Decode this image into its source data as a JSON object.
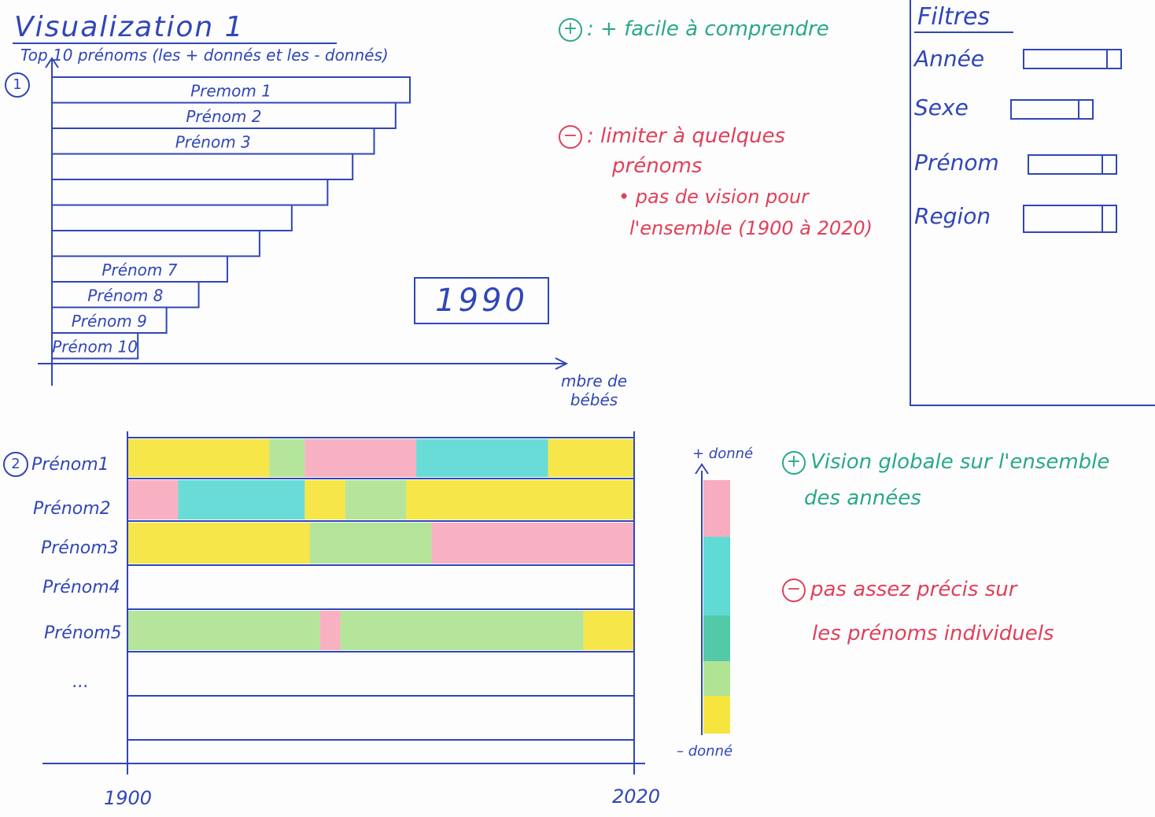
{
  "viz1": {
    "title": "Visualization 1",
    "subtitle": "Top 10 prénoms (les + donnés et les - donnés)",
    "number": "1",
    "bars": [
      {
        "label": "Premom 1",
        "value": 10
      },
      {
        "label": "Prénom 2",
        "value": 9.6
      },
      {
        "label": "Prénom 3",
        "value": 9.0
      },
      {
        "label": "",
        "value": 8.4
      },
      {
        "label": "",
        "value": 7.7
      },
      {
        "label": "",
        "value": 6.7
      },
      {
        "label": "",
        "value": 5.8
      },
      {
        "label": "Prénom 7",
        "value": 4.9
      },
      {
        "label": "Prénom 8",
        "value": 4.1
      },
      {
        "label": "Prénom 9",
        "value": 3.2
      },
      {
        "label": "Prénom 10",
        "value": 2.4
      }
    ],
    "year": "1990",
    "xaxis_label_1": "mbre de",
    "xaxis_label_2": "bébés",
    "pro": ": + facile à comprendre",
    "con": ": limiter à quelques",
    "con_line2": "prénoms",
    "con_line3": "• pas de vision pour",
    "con_line4": "l'ensemble (1900 à 2020)"
  },
  "filters": {
    "title": "Filtres",
    "items": [
      {
        "label": "Année"
      },
      {
        "label": "Sexe"
      },
      {
        "label": "Prénom"
      },
      {
        "label": "Region"
      }
    ]
  },
  "viz2": {
    "number": "2",
    "rows": [
      "Prénom1",
      "Prénom2",
      "Prénom3",
      "Prénom4",
      "Prénom5",
      "..."
    ],
    "year_start": "1900",
    "year_end": "2020",
    "legend_top": "+ donné",
    "legend_bottom": "– donné",
    "pro": "Vision globale sur l'ensemble",
    "pro_line2": "des années",
    "con": "pas assez précis sur",
    "con_line2": "les prénoms individuels",
    "colors": {
      "yellow": "#f5e22a",
      "green": "#a8e08a",
      "pink": "#f7a3b8",
      "cyan": "#4fd6d0",
      "teal": "#3fc3a0"
    }
  }
}
